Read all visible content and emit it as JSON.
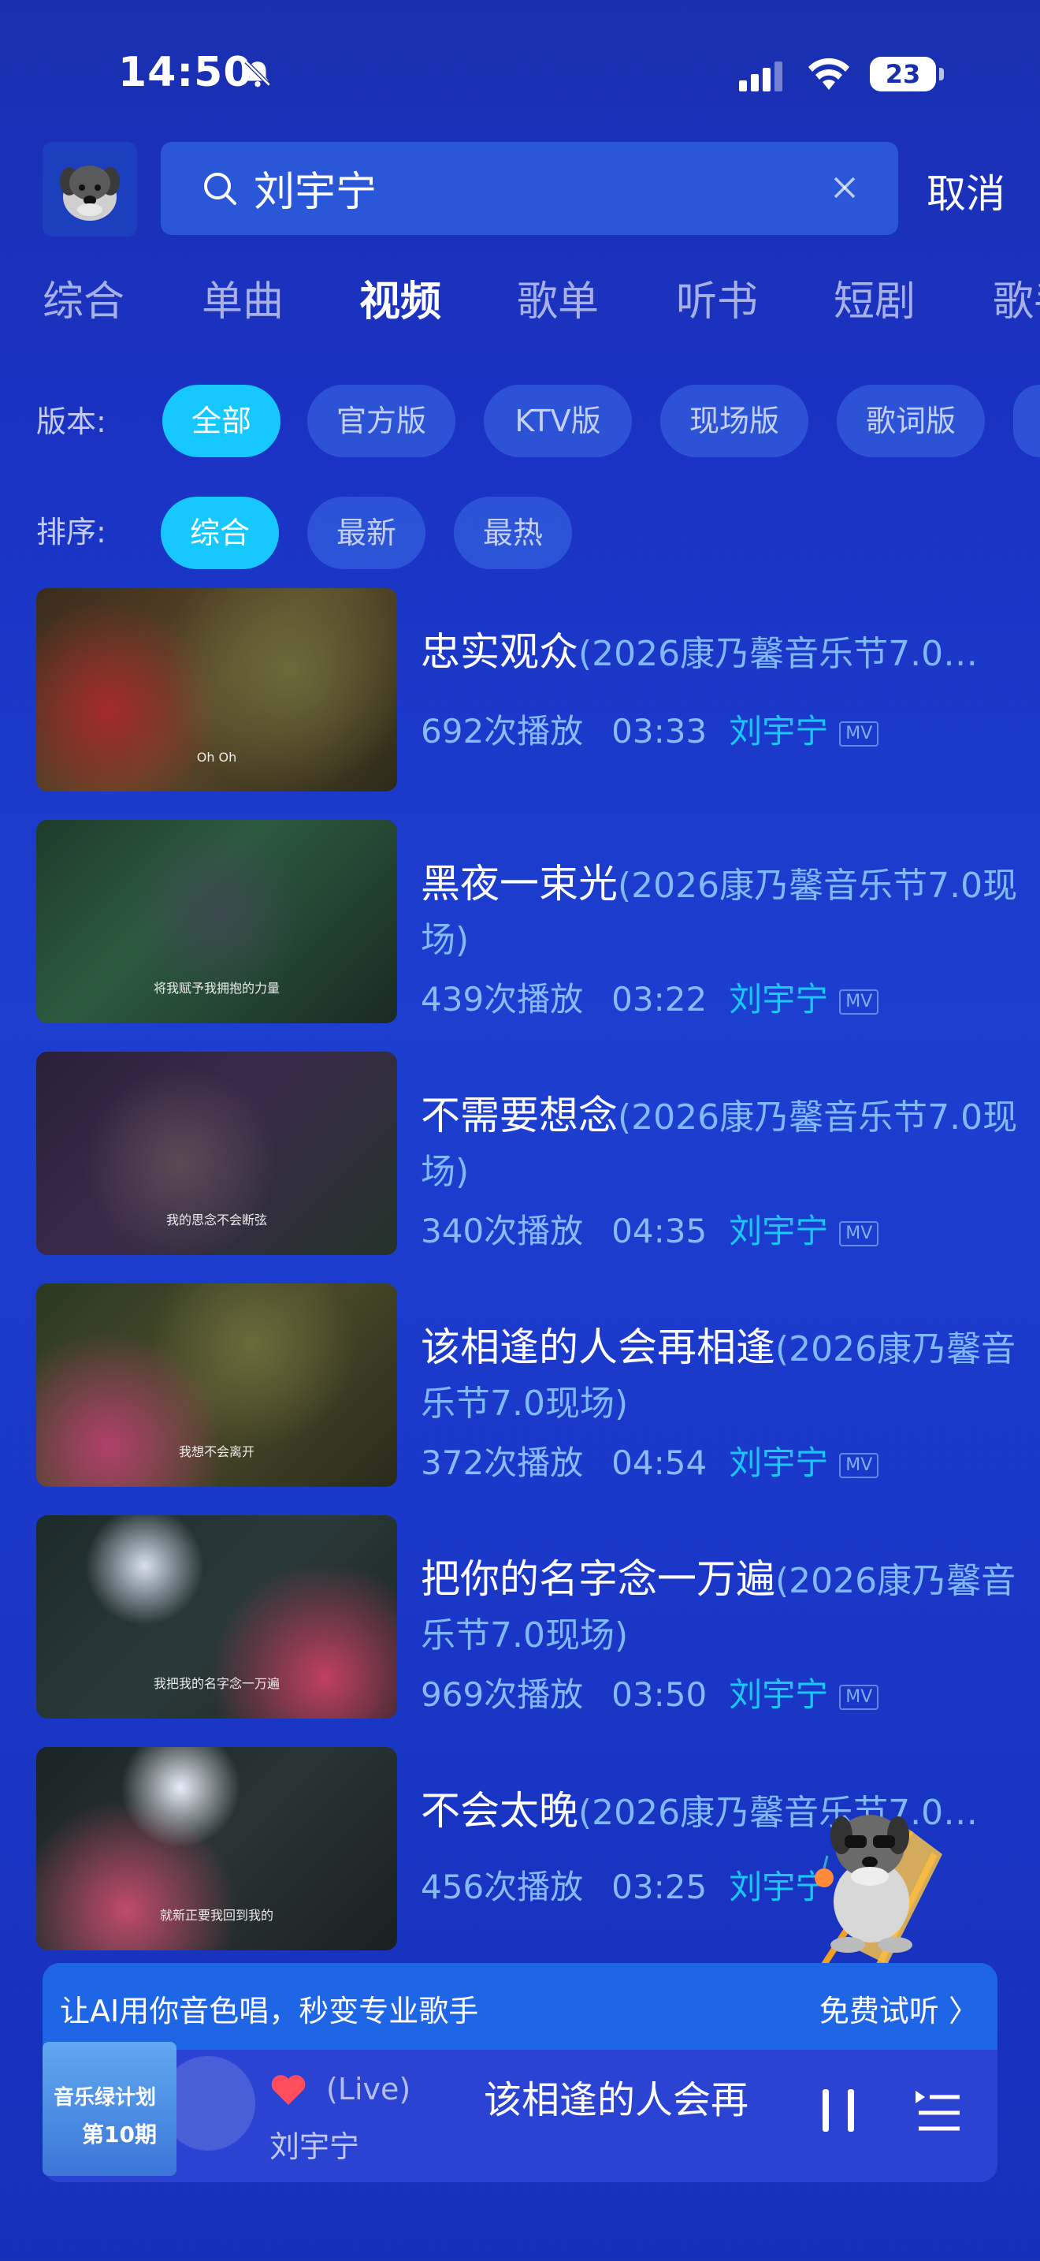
{
  "status": {
    "time": "14:50",
    "battery": "23"
  },
  "search": {
    "query": "刘宇宁",
    "cancel": "取消"
  },
  "tabs": [
    {
      "label": "综合",
      "active": false
    },
    {
      "label": "单曲",
      "active": false
    },
    {
      "label": "视频",
      "active": true
    },
    {
      "label": "歌单",
      "active": false
    },
    {
      "label": "听书",
      "active": false
    },
    {
      "label": "短剧",
      "active": false
    },
    {
      "label": "歌手",
      "active": false
    }
  ],
  "filters": {
    "version_label": "版本:",
    "version_chips": [
      "全部",
      "官方版",
      "KTV版",
      "现场版",
      "歌词版"
    ],
    "sort_label": "排序:",
    "sort_chips": [
      "综合",
      "最新",
      "最热"
    ]
  },
  "videos": [
    {
      "title": "忠实观众",
      "subtitle": "(2026康乃馨音乐节7.0…",
      "plays": "692次播放",
      "duration": "03:33",
      "artist": "刘宇宁",
      "badge": "MV",
      "caption": "Oh Oh"
    },
    {
      "title": "黑夜一束光",
      "subtitle": "(2026康乃馨音乐节7.0现场)",
      "plays": "439次播放",
      "duration": "03:22",
      "artist": "刘宇宁",
      "badge": "MV",
      "caption": "将我赋予我拥抱的力量"
    },
    {
      "title": "不需要想念",
      "subtitle": "(2026康乃馨音乐节7.0现场)",
      "plays": "340次播放",
      "duration": "04:35",
      "artist": "刘宇宁",
      "badge": "MV",
      "caption": "我的思念不会断弦"
    },
    {
      "title": "该相逢的人会再相逢",
      "subtitle": "(2026康乃馨音乐节7.0现场)",
      "plays": "372次播放",
      "duration": "04:54",
      "artist": "刘宇宁",
      "badge": "MV",
      "caption": "我想不会离开"
    },
    {
      "title": "把你的名字念一万遍",
      "subtitle": "(2026康乃馨音乐节7.0现场)",
      "plays": "969次播放",
      "duration": "03:50",
      "artist": "刘宇宁",
      "badge": "MV",
      "caption": "我把我的名字念一万遍"
    },
    {
      "title": "不会太晚",
      "subtitle": "(2026康乃馨音乐节7.0…",
      "plays": "456次播放",
      "duration": "03:25",
      "artist": "刘宇宁",
      "badge": "MV",
      "caption": "就新正要我回到我的"
    }
  ],
  "promo": {
    "text": "让AI用你音色唱，秒变专业歌手",
    "link": "免费试听 〉"
  },
  "player": {
    "cover_line1": "音乐绿计划",
    "cover_line2": "第10期",
    "live": "(Live)",
    "song": "该相逢的人会再",
    "artist": "刘宇宁"
  },
  "colors": {
    "accent": "#16c8ff",
    "background": "#1a33c4",
    "heart": "#ff4d5e"
  }
}
